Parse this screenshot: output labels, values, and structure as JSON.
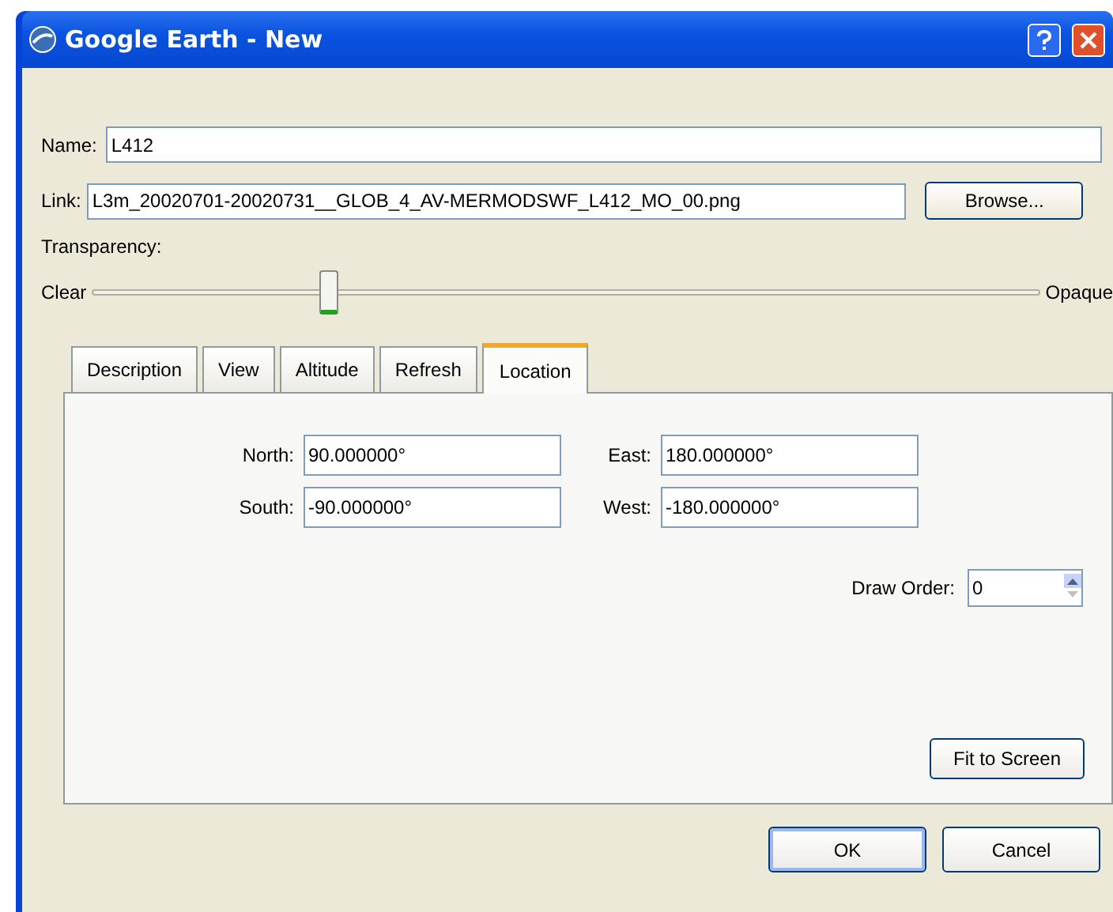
{
  "window": {
    "title": "Google Earth - New"
  },
  "name": {
    "label": "Name:",
    "value": "L412"
  },
  "link": {
    "label": "Link:",
    "value": "L3m_20020701-20020731__GLOB_4_AV-MERMODSWF_L412_MO_00.png",
    "button": "Browse..."
  },
  "transparency": {
    "label": "Transparency:",
    "min_label": "Clear",
    "max_label": "Opaque",
    "level": 0.25
  },
  "tabs": [
    {
      "label": "Description",
      "selected": false
    },
    {
      "label": "View",
      "selected": false
    },
    {
      "label": "Altitude",
      "selected": false
    },
    {
      "label": "Refresh",
      "selected": false
    },
    {
      "label": "Location",
      "selected": true
    }
  ],
  "location": {
    "fields": [
      {
        "label": "North:",
        "value": "90.000000°"
      },
      {
        "label": "East:",
        "value": "180.000000°"
      },
      {
        "label": "South:",
        "value": "-90.000000°"
      },
      {
        "label": "West:",
        "value": "-180.000000°"
      }
    ],
    "draw_order": {
      "label": "Draw Order:",
      "value": "0"
    },
    "fit_button": "Fit to Screen"
  },
  "buttons": [
    {
      "label": "OK",
      "default": true
    },
    {
      "label": "Cancel",
      "default": false
    }
  ]
}
